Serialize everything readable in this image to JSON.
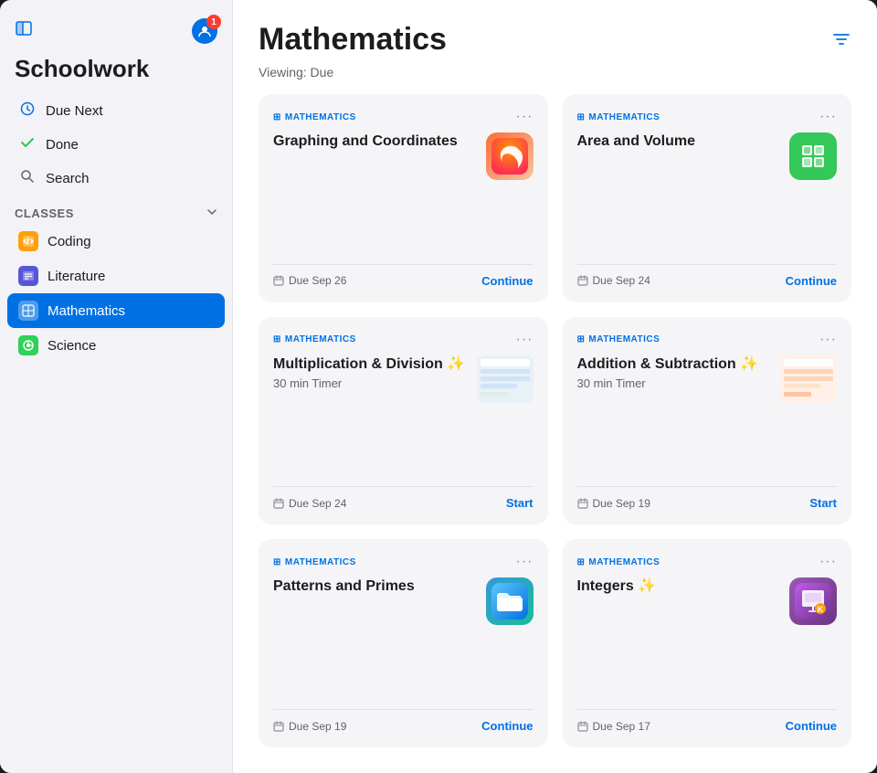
{
  "sidebar": {
    "title": "Schoolwork",
    "toggleIcon": "⊞",
    "userIcon": "👤",
    "notificationCount": "1",
    "navItems": [
      {
        "id": "due-next",
        "label": "Due Next",
        "icon": "🕐",
        "iconType": "clock"
      },
      {
        "id": "done",
        "label": "Done",
        "icon": "✓",
        "iconType": "check"
      },
      {
        "id": "search",
        "label": "Search",
        "icon": "🔍",
        "iconType": "search"
      }
    ],
    "classesLabel": "Classes",
    "classes": [
      {
        "id": "coding",
        "label": "Coding",
        "icon": "📋",
        "color": "#ff9f0a",
        "active": false
      },
      {
        "id": "literature",
        "label": "Literature",
        "icon": "📊",
        "color": "#5856d6",
        "active": false
      },
      {
        "id": "mathematics",
        "label": "Mathematics",
        "icon": "⊞",
        "color": "#0071e3",
        "active": true
      },
      {
        "id": "science",
        "label": "Science",
        "icon": "✳",
        "color": "#30d158",
        "active": false
      }
    ]
  },
  "main": {
    "title": "Mathematics",
    "viewingLabel": "Viewing: Due",
    "filterIcon": "⊟",
    "cards": [
      {
        "id": "graphing",
        "subject": "MATHEMATICS",
        "title": "Graphing and Coordinates",
        "subtitle": "",
        "timer": "",
        "dueDate": "Due Sep 26",
        "action": "Continue",
        "appIconType": "swift",
        "hasAppIcon": true
      },
      {
        "id": "area-volume",
        "subject": "MATHEMATICS",
        "title": "Area and Volume",
        "subtitle": "",
        "timer": "",
        "dueDate": "Due Sep 24",
        "action": "Continue",
        "appIconType": "numbers",
        "hasAppIcon": true
      },
      {
        "id": "multiplication",
        "subject": "MATHEMATICS",
        "title": "Multiplication & Division ✨",
        "subtitle": "30 min Timer",
        "timer": "30 min Timer",
        "dueDate": "Due Sep 24",
        "action": "Start",
        "appIconType": "thumbnail-math",
        "hasAppIcon": false
      },
      {
        "id": "addition",
        "subject": "MATHEMATICS",
        "title": "Addition & Subtraction ✨",
        "subtitle": "30 min Timer",
        "timer": "30 min Timer",
        "dueDate": "Due Sep 19",
        "action": "Start",
        "appIconType": "thumbnail-colorful",
        "hasAppIcon": false
      },
      {
        "id": "patterns",
        "subject": "MATHEMATICS",
        "title": "Patterns and Primes",
        "subtitle": "",
        "timer": "",
        "dueDate": "Due Sep 19",
        "action": "Continue",
        "appIconType": "files",
        "hasAppIcon": true
      },
      {
        "id": "integers",
        "subject": "MATHEMATICS",
        "title": "Integers ✨",
        "subtitle": "",
        "timer": "",
        "dueDate": "Due Sep 17",
        "action": "Continue",
        "appIconType": "keynote",
        "hasAppIcon": true
      }
    ]
  }
}
